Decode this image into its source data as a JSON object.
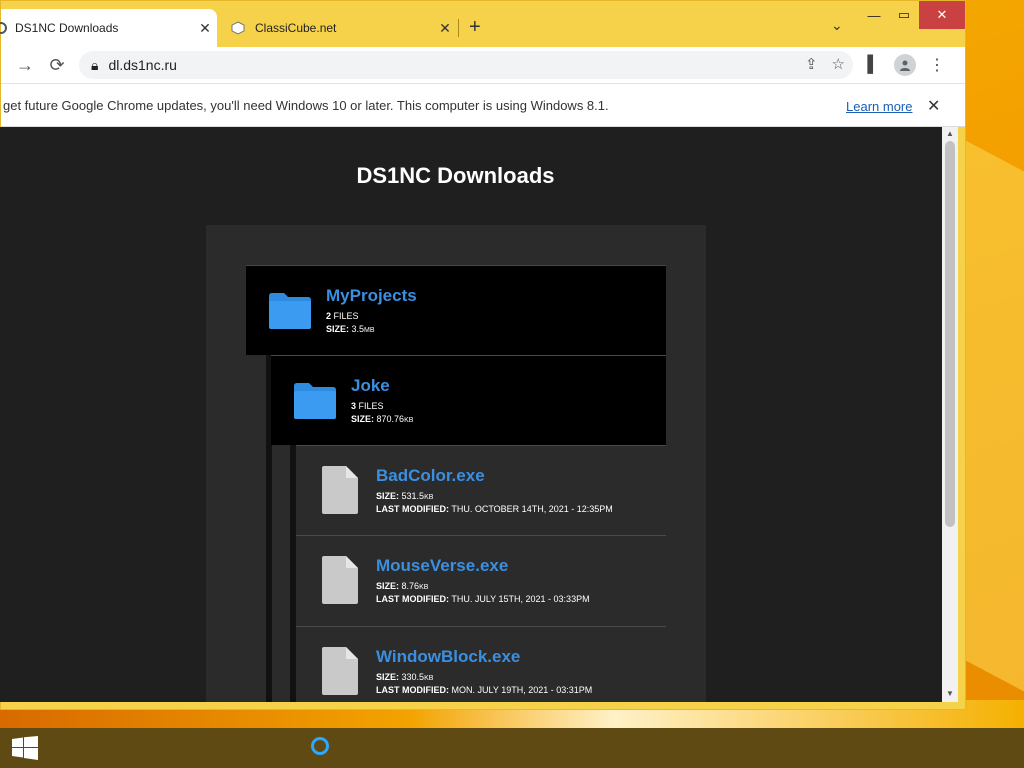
{
  "browser": {
    "tabs": [
      {
        "title": "DS1NC Downloads",
        "active": true
      },
      {
        "title": "ClassiCube.net",
        "active": false
      }
    ],
    "new_tab_label": "+",
    "url": "dl.ds1nc.ru",
    "infobar": {
      "message": "get future Google Chrome updates, you'll need Windows 10 or later. This computer is using Windows 8.1.",
      "link": "Learn more"
    }
  },
  "page": {
    "title": "DS1NC Downloads",
    "entries": [
      {
        "type": "folder",
        "name": "MyProjects",
        "files_count": "2",
        "files_label": "FILES",
        "size_label": "SIZE:",
        "size": "3.5",
        "size_unit": "MB"
      },
      {
        "type": "folder",
        "name": "Joke",
        "files_count": "3",
        "files_label": "FILES",
        "size_label": "SIZE:",
        "size": "870.76",
        "size_unit": "KB"
      },
      {
        "type": "file",
        "name": "BadColor.exe",
        "size_label": "SIZE:",
        "size": "531.5",
        "size_unit": "KB",
        "modified_label": "LAST MODIFIED:",
        "modified": "THU. OCTOBER 14TH, 2021 - 12:35PM"
      },
      {
        "type": "file",
        "name": "MouseVerse.exe",
        "size_label": "SIZE:",
        "size": "8.76",
        "size_unit": "KB",
        "modified_label": "LAST MODIFIED:",
        "modified": "THU. JULY 15TH, 2021 - 03:33PM"
      },
      {
        "type": "file",
        "name": "WindowBlock.exe",
        "size_label": "SIZE:",
        "size": "330.5",
        "size_unit": "KB",
        "modified_label": "LAST MODIFIED:",
        "modified": "MON. JULY 19TH, 2021 - 03:31PM"
      }
    ]
  },
  "colors": {
    "link_blue": "#3b8fe0",
    "page_bg": "#1f1f1f",
    "folder_blue": "#2f8be0",
    "file_gray": "#c9c9c9",
    "chrome_frame": "#f6d24a",
    "taskbar": "#5f4a13"
  },
  "icons": [
    "folder-icon",
    "file-icon",
    "lock-icon",
    "share-icon",
    "star-icon",
    "sidepanel-icon",
    "profile-icon",
    "menu-icon",
    "windows-start-icon",
    "cortana-icon"
  ]
}
